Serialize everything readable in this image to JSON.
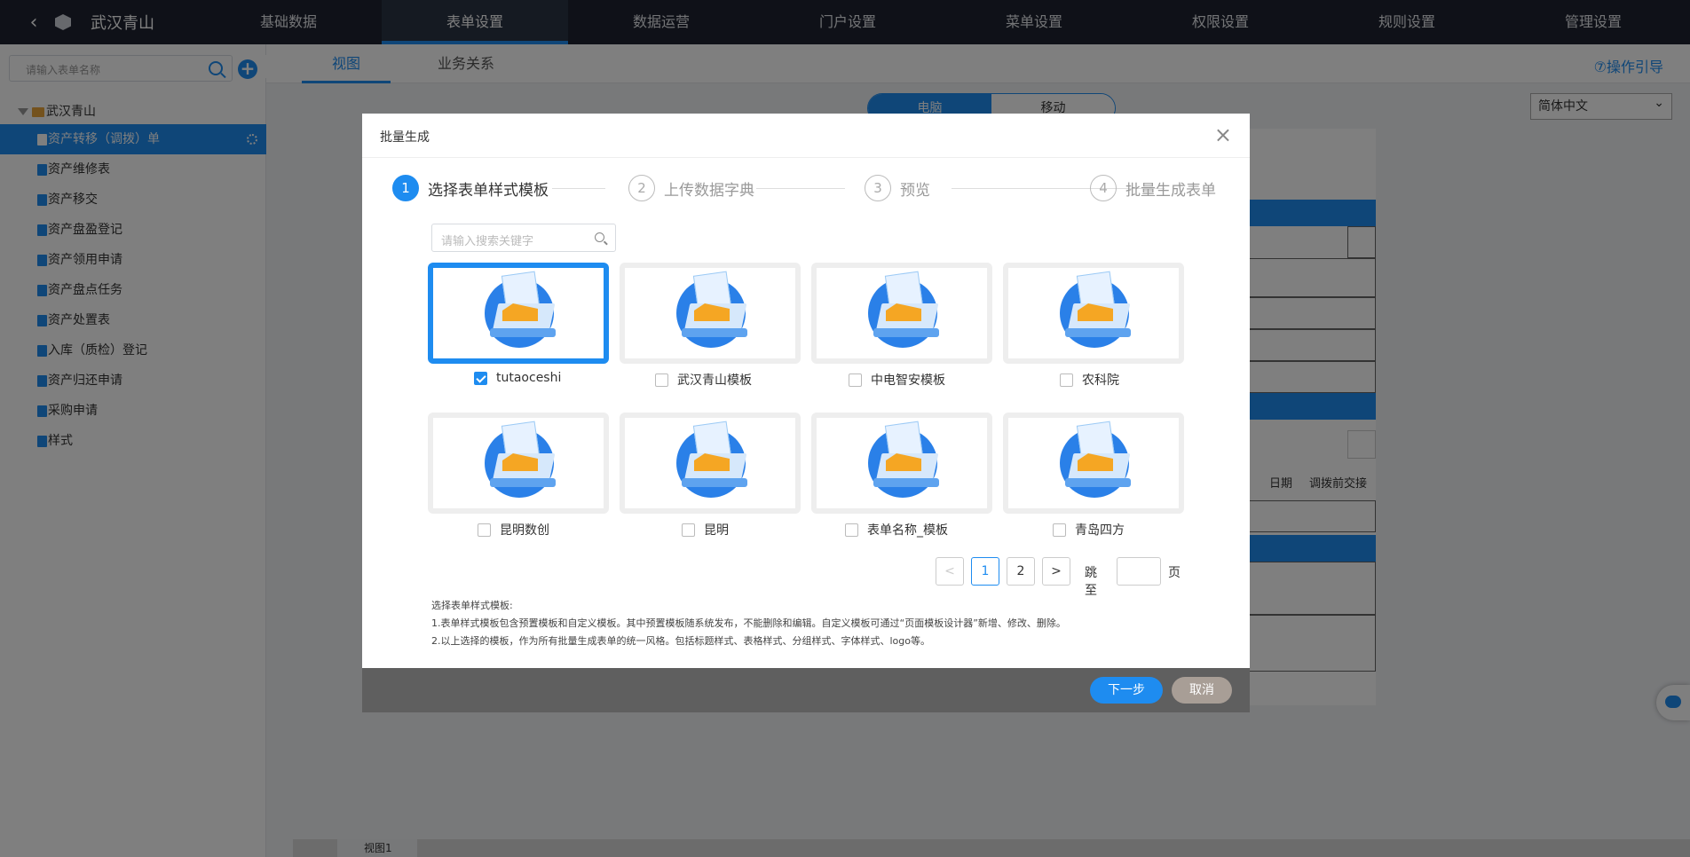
{
  "topnav": {
    "app_title": "武汉青山",
    "menu": [
      "基础数据",
      "表单设置",
      "数据运营",
      "门户设置",
      "菜单设置",
      "权限设置",
      "规则设置",
      "管理设置"
    ],
    "active_index": 1
  },
  "sidebar": {
    "search_placeholder": "请输入表单名称",
    "root_label": "武汉青山",
    "items": [
      {
        "label": "资产转移（调拨）单",
        "active": true
      },
      {
        "label": "资产维修表"
      },
      {
        "label": "资产移交"
      },
      {
        "label": "资产盘盈登记"
      },
      {
        "label": "资产领用申请"
      },
      {
        "label": "资产盘点任务"
      },
      {
        "label": "资产处置表"
      },
      {
        "label": "入库（质检）登记"
      },
      {
        "label": "资产归还申请"
      },
      {
        "label": "采购申请"
      },
      {
        "label": "样式"
      }
    ]
  },
  "main": {
    "tabs": [
      "视图",
      "业务关系"
    ],
    "guide_label": "⑦操作引导",
    "device": {
      "pc": "电脑",
      "mobile": "移动"
    },
    "language": "简体中文",
    "canvas_labels": {
      "date": "日期",
      "before": "调拨前交接"
    },
    "bottom_tab": "视图1"
  },
  "modal": {
    "title": "批量生成",
    "close": "×",
    "steps": [
      {
        "num": "1",
        "label": "选择表单样式模板",
        "active": true
      },
      {
        "num": "2",
        "label": "上传数据字典"
      },
      {
        "num": "3",
        "label": "预览"
      },
      {
        "num": "4",
        "label": "批量生成表单"
      }
    ],
    "search_placeholder": "请输入搜索关键字",
    "templates": [
      {
        "name": "tutaoceshi",
        "checked": true
      },
      {
        "name": "武汉青山模板",
        "checked": false
      },
      {
        "name": "中电智安模板",
        "checked": false
      },
      {
        "name": "农科院",
        "checked": false
      },
      {
        "name": "昆明数创",
        "checked": false
      },
      {
        "name": "昆明",
        "checked": false
      },
      {
        "name": "表单名称_模板",
        "checked": false
      },
      {
        "name": "青岛四方",
        "checked": false
      }
    ],
    "pagination": {
      "prev": "<",
      "pages": [
        "1",
        "2"
      ],
      "current": "1",
      "next": ">",
      "jump_label": "跳至",
      "page_unit": "页"
    },
    "notes": {
      "title": "选择表单样式模板:",
      "line1": "1.表单样式模板包含预置模板和自定义模板。其中预置模板随系统发布，不能删除和编辑。自定义模板可通过“页面模板设计器”新增、修改、删除。",
      "line2": "2.以上选择的模板，作为所有批量生成表单的统一风格。包括标题样式、表格样式、分组样式、字体样式、logo等。"
    },
    "buttons": {
      "next": "下一步",
      "cancel": "取消"
    }
  },
  "colors": {
    "accent": "#1e8cf0",
    "nav_bg": "#1e2330"
  }
}
